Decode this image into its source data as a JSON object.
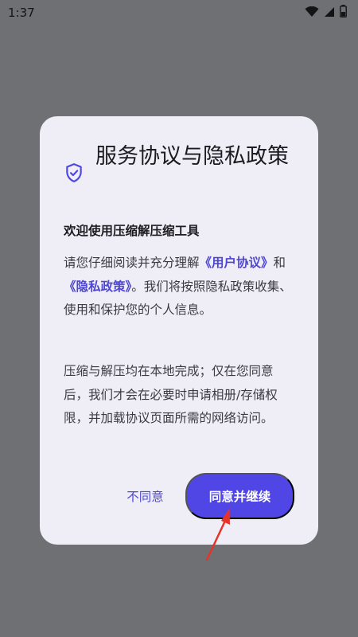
{
  "status_bar": {
    "time": "1:37",
    "icons": [
      "wifi-icon",
      "signal-icon",
      "battery-icon"
    ]
  },
  "dialog": {
    "title": "服务协议与隐私政策",
    "welcome": "欢迎使用压缩解压缩工具",
    "para1": {
      "pre": "请您仔细阅读并充分理解",
      "link1": "《用户协议》",
      "mid": "和",
      "link2": "《隐私政策》",
      "post": "。我们将按照隐私政策收集、使用和保护您的个人信息。"
    },
    "para2": "压缩与解压均在本地完成；仅在您同意后，我们才会在必要时申请相册/存储权限，并加载协议页面所需的网络访问。",
    "buttons": {
      "disagree": "不同意",
      "agree": "同意并继续"
    }
  },
  "colors": {
    "scrim": "#6f7073",
    "dialog_bg": "#efeef6",
    "accent": "#4f46e5",
    "link": "#4e46d3",
    "annotation_arrow": "#e5332a"
  }
}
